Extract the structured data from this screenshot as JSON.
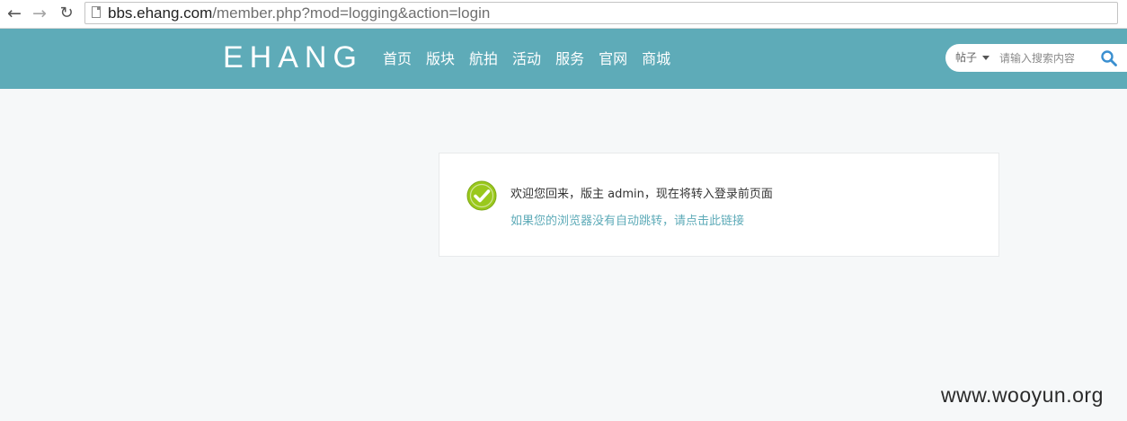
{
  "browser": {
    "url_host": "bbs.ehang.com",
    "url_path": "/member.php?mod=logging&action=login",
    "back_icon": "←",
    "forward_icon": "→",
    "reload_icon": "↻"
  },
  "header": {
    "logo": "EHANG",
    "nav": [
      "首页",
      "版块",
      "航拍",
      "活动",
      "服务",
      "官网",
      "商城"
    ],
    "search": {
      "type_label": "帖子",
      "placeholder": "请输入搜索内容"
    },
    "colors": {
      "header_bg": "#5eabb8",
      "accent": "#5eabb8"
    }
  },
  "message": {
    "text": "欢迎您回来，版主 admin，现在将转入登录前页面",
    "link": "如果您的浏览器没有自动跳转，请点击此链接",
    "icon": "check-circle-icon",
    "icon_color": "#9ac81c"
  },
  "watermark": "www.wooyun.org"
}
